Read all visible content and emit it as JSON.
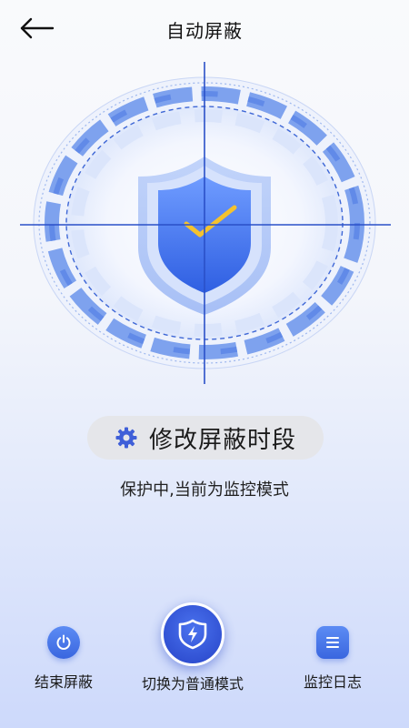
{
  "header": {
    "title": "自动屏蔽"
  },
  "main": {
    "modify_period_label": "修改屏蔽时段",
    "status_text": "保护中,当前为监控模式"
  },
  "bottom": {
    "end_label": "结束屏蔽",
    "switch_label": "切换为普通模式",
    "log_label": "监控日志"
  },
  "icons": {
    "back": "arrow-left-icon",
    "gear": "gear-icon",
    "power": "power-icon",
    "bolt_shield": "lightning-shield-icon",
    "list": "list-icon",
    "shield_check": "shield-check-icon"
  },
  "colors": {
    "accent": "#3a66df",
    "accent_light": "#5c8cf4",
    "pill_bg": "#e5e6ea",
    "check": "#f4c22e"
  }
}
